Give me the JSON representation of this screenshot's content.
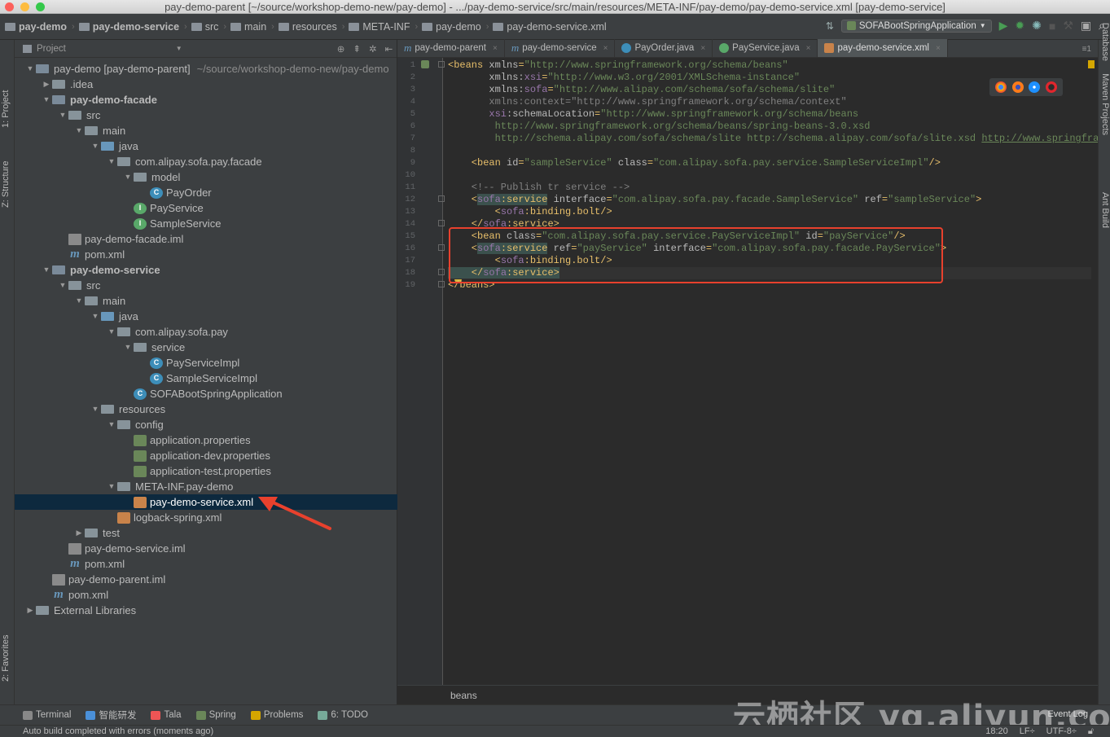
{
  "window": {
    "title": "pay-demo-parent [~/source/workshop-demo-new/pay-demo] - .../pay-demo-service/src/main/resources/META-INF/pay-demo/pay-demo-service.xml [pay-demo-service]"
  },
  "navbar": {
    "crumbs": [
      "pay-demo",
      "pay-demo-service",
      "src",
      "main",
      "resources",
      "META-INF",
      "pay-demo",
      "pay-demo-service.xml"
    ],
    "run_config": "SOFABootSpringApplication"
  },
  "left_strip": {
    "project_tab": "1: Project",
    "structure_tab": "Z: Structure",
    "favorites_tab": "2: Favorites"
  },
  "right_strip": {
    "database_tab": "Database",
    "maven_tab": "Maven Projects",
    "ant_tab": "Ant Build"
  },
  "project_panel": {
    "title": "Project",
    "tree": [
      {
        "label": "pay-demo [pay-demo-parent]",
        "suffix": "~/source/workshop-demo-new/pay-demo",
        "icon": "module-folder-icon",
        "expanded": true,
        "depth": 0
      },
      {
        "label": ".idea",
        "icon": "folder-icon",
        "expanded": false,
        "depth": 1
      },
      {
        "label": "pay-demo-facade",
        "icon": "module-folder-icon",
        "expanded": true,
        "depth": 1,
        "bold": true
      },
      {
        "label": "src",
        "icon": "folder-icon",
        "expanded": true,
        "depth": 2
      },
      {
        "label": "main",
        "icon": "folder-icon",
        "expanded": true,
        "depth": 3
      },
      {
        "label": "java",
        "icon": "source-folder-icon",
        "expanded": true,
        "depth": 4
      },
      {
        "label": "com.alipay.sofa.pay.facade",
        "icon": "package-icon",
        "expanded": true,
        "depth": 5
      },
      {
        "label": "model",
        "icon": "package-icon",
        "expanded": true,
        "depth": 6
      },
      {
        "label": "PayOrder",
        "icon": "class-icon",
        "depth": 7
      },
      {
        "label": "PayService",
        "icon": "interface-icon",
        "depth": 6
      },
      {
        "label": "SampleService",
        "icon": "interface-icon",
        "depth": 6
      },
      {
        "label": "pay-demo-facade.iml",
        "icon": "iml-file-icon",
        "depth": 2
      },
      {
        "label": "pom.xml",
        "icon": "maven-icon",
        "depth": 2
      },
      {
        "label": "pay-demo-service",
        "icon": "module-folder-icon",
        "expanded": true,
        "depth": 1,
        "bold": true
      },
      {
        "label": "src",
        "icon": "folder-icon",
        "expanded": true,
        "depth": 2
      },
      {
        "label": "main",
        "icon": "folder-icon",
        "expanded": true,
        "depth": 3
      },
      {
        "label": "java",
        "icon": "source-folder-icon",
        "expanded": true,
        "depth": 4
      },
      {
        "label": "com.alipay.sofa.pay",
        "icon": "package-icon",
        "expanded": true,
        "depth": 5
      },
      {
        "label": "service",
        "icon": "package-icon",
        "expanded": true,
        "depth": 6
      },
      {
        "label": "PayServiceImpl",
        "icon": "class-icon",
        "depth": 7
      },
      {
        "label": "SampleServiceImpl",
        "icon": "class-icon",
        "depth": 7
      },
      {
        "label": "SOFABootSpringApplication",
        "icon": "spring-class-icon",
        "depth": 6
      },
      {
        "label": "resources",
        "icon": "resources-folder-icon",
        "expanded": true,
        "depth": 4
      },
      {
        "label": "config",
        "icon": "folder-icon",
        "expanded": true,
        "depth": 5
      },
      {
        "label": "application.properties",
        "icon": "spring-properties-icon",
        "depth": 6
      },
      {
        "label": "application-dev.properties",
        "icon": "spring-properties-icon",
        "depth": 6
      },
      {
        "label": "application-test.properties",
        "icon": "spring-properties-icon",
        "depth": 6
      },
      {
        "label": "META-INF.pay-demo",
        "icon": "folder-icon",
        "expanded": true,
        "depth": 5
      },
      {
        "label": "pay-demo-service.xml",
        "icon": "xml-file-icon",
        "depth": 6,
        "selected": true
      },
      {
        "label": "logback-spring.xml",
        "icon": "xml-file-icon",
        "depth": 5
      },
      {
        "label": "test",
        "icon": "folder-icon",
        "expanded": false,
        "depth": 3
      },
      {
        "label": "pay-demo-service.iml",
        "icon": "iml-file-icon",
        "depth": 2
      },
      {
        "label": "pom.xml",
        "icon": "maven-icon",
        "depth": 2
      },
      {
        "label": "pay-demo-parent.iml",
        "icon": "iml-file-icon",
        "depth": 1
      },
      {
        "label": "pom.xml",
        "icon": "maven-icon",
        "depth": 1
      },
      {
        "label": "External Libraries",
        "icon": "libraries-icon",
        "expanded": false,
        "depth": 0
      }
    ]
  },
  "editor": {
    "tabs": [
      {
        "label": "pay-demo-parent",
        "icon": "maven-icon"
      },
      {
        "label": "pay-demo-service",
        "icon": "maven-icon"
      },
      {
        "label": "PayOrder.java",
        "icon": "class-icon"
      },
      {
        "label": "PayService.java",
        "icon": "interface-icon"
      },
      {
        "label": "pay-demo-service.xml",
        "icon": "xml-file-icon",
        "active": true
      }
    ],
    "lines": [
      [
        [
          "tg",
          "<beans "
        ],
        [
          "at",
          "xmlns"
        ],
        [
          "tg",
          "="
        ],
        [
          "av",
          "\"http://www.springframework.org/schema/beans\""
        ]
      ],
      [
        [
          "at",
          "       xmlns:"
        ],
        [
          "ns",
          "xsi"
        ],
        [
          "tg",
          "="
        ],
        [
          "av",
          "\"http://www.w3.org/2001/XMLSchema-instance\""
        ]
      ],
      [
        [
          "at",
          "       xmlns:"
        ],
        [
          "ns",
          "sofa"
        ],
        [
          "tg",
          "="
        ],
        [
          "av",
          "\"http://www.alipay.com/schema/sofa/schema/slite\""
        ]
      ],
      [
        [
          "cm",
          "       xmlns:context=\"http://www.springframework.org/schema/context\""
        ]
      ],
      [
        [
          "ns",
          "       xsi"
        ],
        [
          "at",
          ":schemaLocation"
        ],
        [
          "tg",
          "="
        ],
        [
          "av",
          "\"http://www.springframework.org/schema/beans"
        ]
      ],
      [
        [
          "av",
          "        http://www.springframework.org/schema/beans/spring-beans-3.0.xsd"
        ]
      ],
      [
        [
          "av",
          "        http://schema.alipay.com/sofa/schema/slite http://schema.alipay.com/sofa/slite.xsd "
        ],
        [
          "avu",
          "http://www.springframew"
        ]
      ],
      [],
      [
        [
          "tg",
          "    <bean "
        ],
        [
          "at",
          "id"
        ],
        [
          "tg",
          "="
        ],
        [
          "av",
          "\"sampleService\" "
        ],
        [
          "at",
          "class"
        ],
        [
          "tg",
          "="
        ],
        [
          "av",
          "\"com.alipay.sofa.pay.service.SampleServiceImpl\""
        ],
        [
          "tg",
          "/>"
        ]
      ],
      [],
      [
        [
          "cm",
          "    <!-- Publish tr service -->"
        ]
      ],
      [
        [
          "tg",
          "    <"
        ],
        [
          "nsh",
          "sofa"
        ],
        [
          "tgh",
          ":service"
        ],
        [
          "at",
          " interface"
        ],
        [
          "tg",
          "="
        ],
        [
          "av",
          "\"com.alipay.sofa.pay.facade.SampleService\" "
        ],
        [
          "at",
          "ref"
        ],
        [
          "tg",
          "="
        ],
        [
          "av",
          "\"sampleService\""
        ],
        [
          "tg",
          ">"
        ]
      ],
      [
        [
          "tg",
          "        <"
        ],
        [
          "ns",
          "sofa"
        ],
        [
          "tg",
          ":binding.bolt/>"
        ]
      ],
      [
        [
          "tg",
          "    </"
        ],
        [
          "ns",
          "sofa"
        ],
        [
          "tg",
          ":service>"
        ]
      ],
      [
        [
          "tg",
          "    <bean "
        ],
        [
          "at",
          "class"
        ],
        [
          "tg",
          "="
        ],
        [
          "av",
          "\"com.alipay.sofa.pay.service.PayServiceImpl\" "
        ],
        [
          "at",
          "id"
        ],
        [
          "tg",
          "="
        ],
        [
          "av",
          "\"payService\""
        ],
        [
          "tg",
          "/>"
        ]
      ],
      [
        [
          "tg",
          "    <"
        ],
        [
          "nsh",
          "sofa"
        ],
        [
          "tgh",
          ":service"
        ],
        [
          "at",
          " ref"
        ],
        [
          "tg",
          "="
        ],
        [
          "av",
          "\"payService\" "
        ],
        [
          "at",
          "interface"
        ],
        [
          "tg",
          "="
        ],
        [
          "av",
          "\"com.alipay.sofa.pay.facade.PayService\""
        ],
        [
          "tg",
          ">"
        ]
      ],
      [
        [
          "tg",
          "        <"
        ],
        [
          "ns",
          "sofa"
        ],
        [
          "tg",
          ":binding.bolt/>"
        ]
      ],
      [
        [
          "tgh",
          "    </"
        ],
        [
          "nsh",
          "sofa"
        ],
        [
          "tgh",
          ":service>"
        ]
      ],
      [
        [
          "tg",
          "</beans>"
        ]
      ]
    ],
    "breadcrumb": "beans"
  },
  "bottom_tools": [
    {
      "label": "Terminal",
      "icon": "terminal-icon"
    },
    {
      "label": "智能研发",
      "icon": "ai-dev-icon"
    },
    {
      "label": "Tala",
      "icon": "tala-icon"
    },
    {
      "label": "Spring",
      "icon": "spring-icon"
    },
    {
      "label": "Problems",
      "icon": "warning-icon"
    },
    {
      "label": "6: TODO",
      "icon": "todo-icon"
    }
  ],
  "event_log": "Event Log",
  "status": {
    "message": "Auto build completed with errors (moments ago)",
    "position": "18:20",
    "line_sep": "LF÷",
    "encoding": "UTF-8÷"
  },
  "watermark": "云栖社区 yq.aliyun.com",
  "colors": {
    "accent_red": "#e8412d",
    "selection": "#0d293e"
  }
}
